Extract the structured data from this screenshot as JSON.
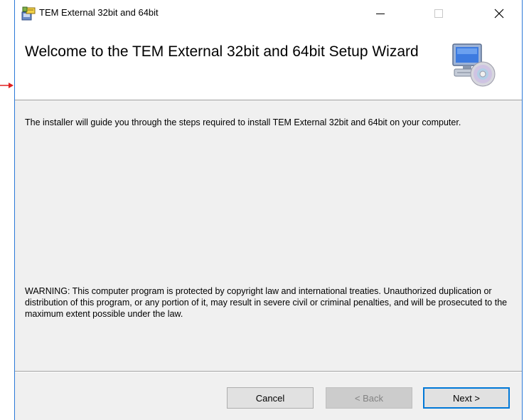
{
  "window": {
    "title": "TEM External 32bit and 64bit"
  },
  "header": {
    "title": "Welcome to the TEM External 32bit and 64bit Setup Wizard"
  },
  "content": {
    "intro": "The installer will guide you through the steps required to install TEM External 32bit and 64bit on your computer.",
    "warning": "WARNING: This computer program is protected by copyright law and international treaties. Unauthorized duplication or distribution of this program, or any portion of it, may result in severe civil or criminal penalties, and will be prosecuted to the maximum extent possible under the law."
  },
  "buttons": {
    "cancel": "Cancel",
    "back": "< Back",
    "next": "Next >"
  },
  "icons": {
    "app": "installer-icon",
    "header": "computer-cd-icon",
    "minimize": "minimize-icon",
    "maximize": "maximize-icon",
    "close": "close-icon"
  },
  "colors": {
    "accent": "#0078d7",
    "window_border": "#2b79d7",
    "arrow": "#e02020"
  }
}
